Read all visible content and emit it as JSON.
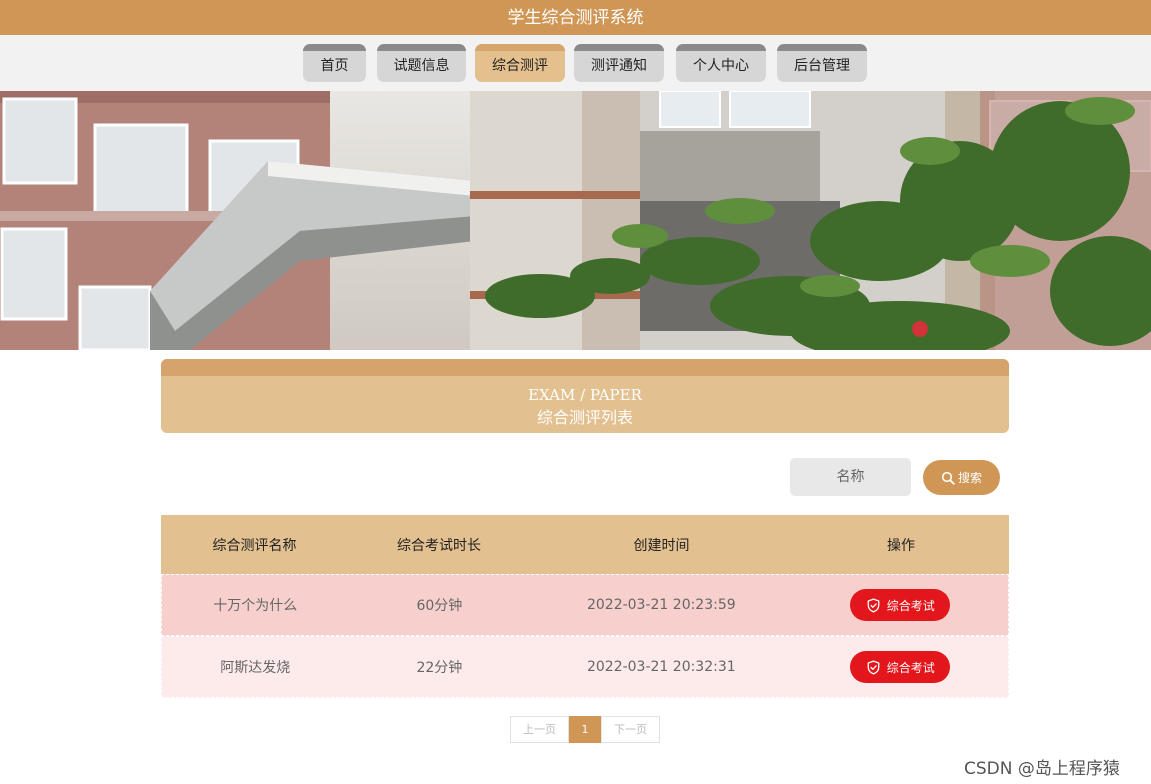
{
  "app": {
    "title": "学生综合测评系统"
  },
  "nav": {
    "items": [
      {
        "label": "首页"
      },
      {
        "label": "试题信息"
      },
      {
        "label": "综合测评",
        "active": true
      },
      {
        "label": "测评通知"
      },
      {
        "label": "个人中心"
      },
      {
        "label": "后台管理"
      }
    ]
  },
  "section": {
    "title_en": "EXAM / PAPER",
    "title_cn": "综合测评列表"
  },
  "search": {
    "placeholder": "名称",
    "button_label": "搜索"
  },
  "table": {
    "headers": [
      "综合测评名称",
      "综合考试时长",
      "创建时间",
      "操作"
    ],
    "rows": [
      {
        "name": "十万个为什么",
        "duration": "60分钟",
        "created": "2022-03-21 20:23:59",
        "action": "综合考试"
      },
      {
        "name": "阿斯达发烧",
        "duration": "22分钟",
        "created": "2022-03-21 20:32:31",
        "action": "综合考试"
      }
    ]
  },
  "pagination": {
    "prev": "上一页",
    "current": "1",
    "next": "下一页"
  },
  "watermark": "CSDN @岛上程序猿",
  "colors": {
    "brand": "#cf9656",
    "header_bg": "#e2c08f",
    "danger": "#e2161b",
    "row1": "#f7d0ce",
    "row2": "#fcebea"
  }
}
